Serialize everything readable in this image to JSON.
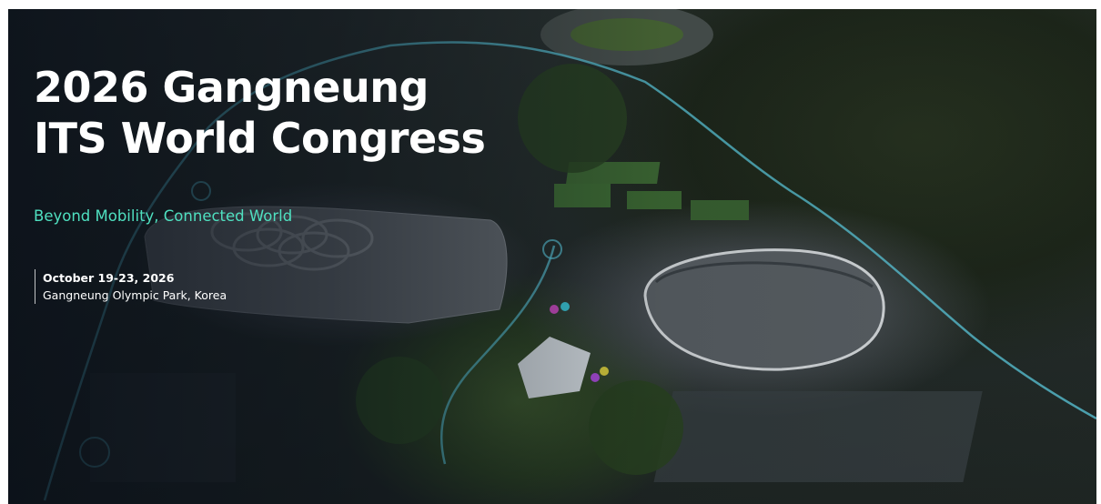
{
  "hero": {
    "title_line1": "2026 Gangneung",
    "title_line2": "ITS World Congress",
    "tagline": "Beyond Mobility, Connected World",
    "dates": "October 19-23, 2026",
    "venue": "Gangneung Olympic Park, Korea"
  },
  "colors": {
    "tagline": "#4fe0c0",
    "route_glow": "#5fd2e6",
    "title": "#ffffff"
  }
}
